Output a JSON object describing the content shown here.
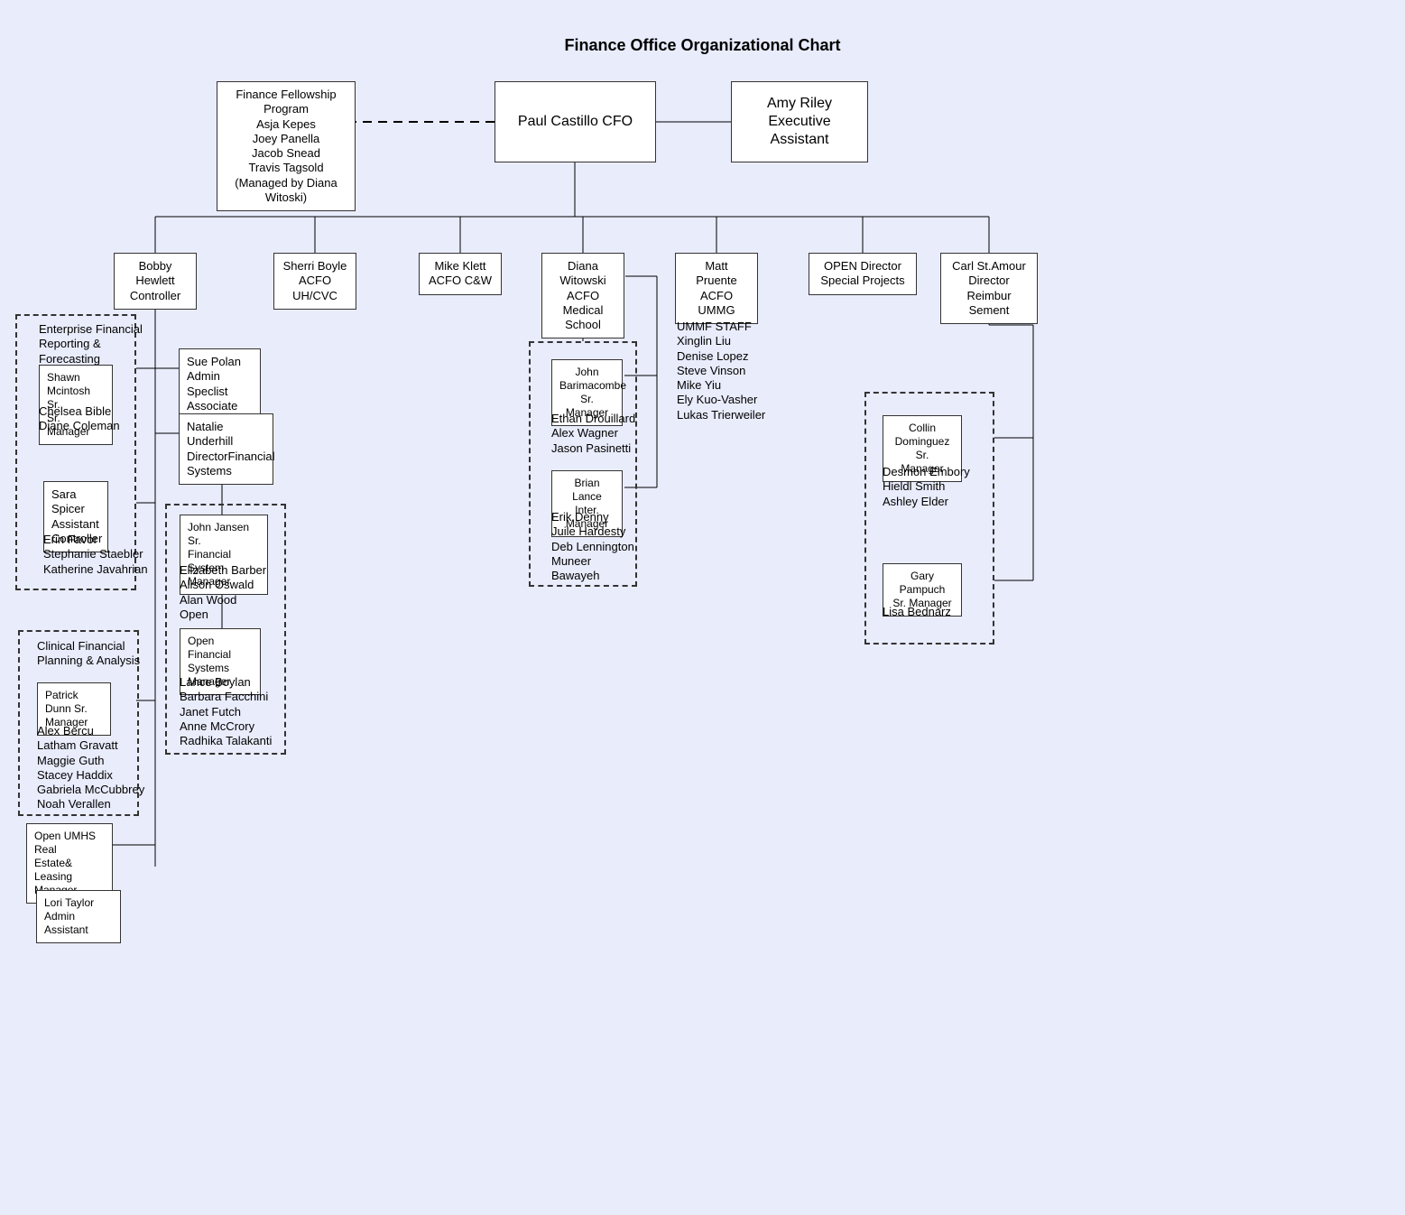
{
  "title": "Finance Office Organizational Chart",
  "chart_data": {
    "type": "table",
    "root": {
      "name": "Paul Castillo CFO",
      "aux_solid": {
        "name": "Amy Riley",
        "title": "Executive Assistant"
      },
      "aux_dotted": {
        "name": "Finance Fellowship Program",
        "members": [
          "Asja Kepes",
          "Joey Panella",
          "Jacob Snead",
          "Travis Tagsold"
        ],
        "note": "(Managed by Diana Witoski)"
      },
      "children": [
        {
          "name": "Bobby Hewlett",
          "title": "Controller"
        },
        {
          "name": "Sherri Boyle",
          "title": "ACFO UH/CVC"
        },
        {
          "name": "Mike Klett",
          "title": "ACFO C&W"
        },
        {
          "name": "Diana Witowski",
          "title": "ACFO Medical School"
        },
        {
          "name": "Matt Pruente",
          "title": "ACFO UMMG"
        },
        {
          "name": "OPEN Director",
          "title": "Special Projects"
        },
        {
          "name": "Carl St.Amour",
          "title": "Director Reimbur Sement"
        }
      ]
    }
  },
  "top": {
    "fellowship": {
      "l1": "Finance Fellowship Program",
      "l2": "Asja Kepes",
      "l3": "Joey Panella",
      "l4": "Jacob Snead",
      "l5": "Travis Tagsold",
      "l6": "(Managed by Diana Witoski)"
    },
    "cfo": "Paul Castillo CFO",
    "ea": {
      "l1": "Amy Riley",
      "l2": "Executive Assistant"
    }
  },
  "row2": {
    "controller": {
      "l1": "Bobby Hewlett",
      "l2": "Controller"
    },
    "sherri": {
      "l1": "Sherri Boyle",
      "l2": "ACFO UH/CVC"
    },
    "mike": {
      "l1": "Mike Klett",
      "l2": "ACFO C&W"
    },
    "diana": {
      "l1": "Diana Witowski",
      "l2": "ACFO Medical",
      "l3": "School"
    },
    "matt": {
      "l1": "Matt Pruente",
      "l2": "ACFO UMMG"
    },
    "open": {
      "l1": "OPEN Director",
      "l2": "Special Projects"
    },
    "carl": {
      "l1": "Carl St.Amour",
      "l2": "Director",
      "l3": "Reimbur Sement"
    }
  },
  "bobby": {
    "sue": {
      "l1": "Sue Polan",
      "l2": "Admin Speclist",
      "l3": "Associate"
    },
    "natalie": {
      "l1": "Natalie Underhill",
      "l2": "DirectorFinancial",
      "l3": "Systems"
    },
    "efrf": {
      "hdr1": "Enterprise Financial",
      "hdr2": "Reporting &",
      "hdr3": "Forecasting",
      "shawn": {
        "l1": "Shawn Mcintosh Sr.",
        "l2": "Sr. Manager"
      },
      "mem1": "Chelsea Bible",
      "mem2": "Diane Coleman"
    },
    "sara": {
      "box": {
        "l1": "Sara Spicer",
        "l2": "Assistant",
        "l3": "Controller"
      },
      "mem1": "Erin Favor",
      "mem2": "Stephanie Staebler",
      "mem3": "Katherine Javahrian"
    },
    "cfpa": {
      "hdr1": "Clinical Financial",
      "hdr2": "Planning & Analysis",
      "patrick": {
        "l1": "Patrick Dunn Sr.",
        "l2": "Manager"
      },
      "mem1": "Alex Bercu",
      "mem2": "Latham Gravatt",
      "mem3": "Maggie Guth",
      "mem4": "Stacey Haddix",
      "mem5": "Gabriela McCubbrey",
      "mem6": "Noah Verallen"
    },
    "umhs": {
      "l1": "Open UMHS Real",
      "l2": "Estate& Leasing",
      "l3": "Manager"
    },
    "lori": {
      "l1": "Lori Taylor",
      "l2": "Admin Assistant"
    }
  },
  "natalieGroup": {
    "john": {
      "l1": "John Jansen Sr.",
      "l2": "Financial System",
      "l3": "Manager"
    },
    "members1": {
      "l1": "Elizabeth Barber",
      "l2": "Alison Oswald",
      "l3": "Alan Wood",
      "l4": "Open"
    },
    "open": {
      "l1": "Open Financial",
      "l2": "Systems",
      "l3": "Manager"
    },
    "members2": {
      "l1": "Lance Boylan",
      "l2": "Barbara Facchini",
      "l3": "Janet Futch",
      "l4": "Anne McCrory",
      "l5": "Radhika Talakanti"
    }
  },
  "dianaGroup": {
    "john": {
      "l1": "John",
      "l2": "Barimacombe",
      "l3": "Sr. Manager"
    },
    "members1": {
      "l1": "Ethan Drouillard",
      "l2": "Alex Wagner",
      "l3": "Jason Pasinetti"
    },
    "brian": {
      "l1": "Brian Lance",
      "l2": "Inter. Manager"
    },
    "members2": {
      "l1": "Erik Denny",
      "l2": "Juile Hardesty",
      "l3": "Deb Lennington",
      "l4": "Muneer",
      "l5": "Bawayeh"
    }
  },
  "ummf": {
    "hdr": "UMMF STAFF",
    "l1": "Xinglin Liu",
    "l2": "Denise Lopez",
    "l3": "Steve Vinson",
    "l4": "Mike Yiu",
    "l5": "Ely Kuo-Vasher",
    "l6": "Lukas Trierweiler"
  },
  "carlGroup": {
    "collin": {
      "l1": "Collin",
      "l2": "Dominguez Sr.",
      "l3": "Manager"
    },
    "members1": {
      "l1": "Desmon Embory",
      "l2": "Hieldl Smith",
      "l3": "Ashley Elder"
    },
    "gary": {
      "l1": "Gary Pampuch",
      "l2": "Sr. Manager"
    },
    "members2": {
      "l1": "Lisa Bednarz"
    }
  }
}
